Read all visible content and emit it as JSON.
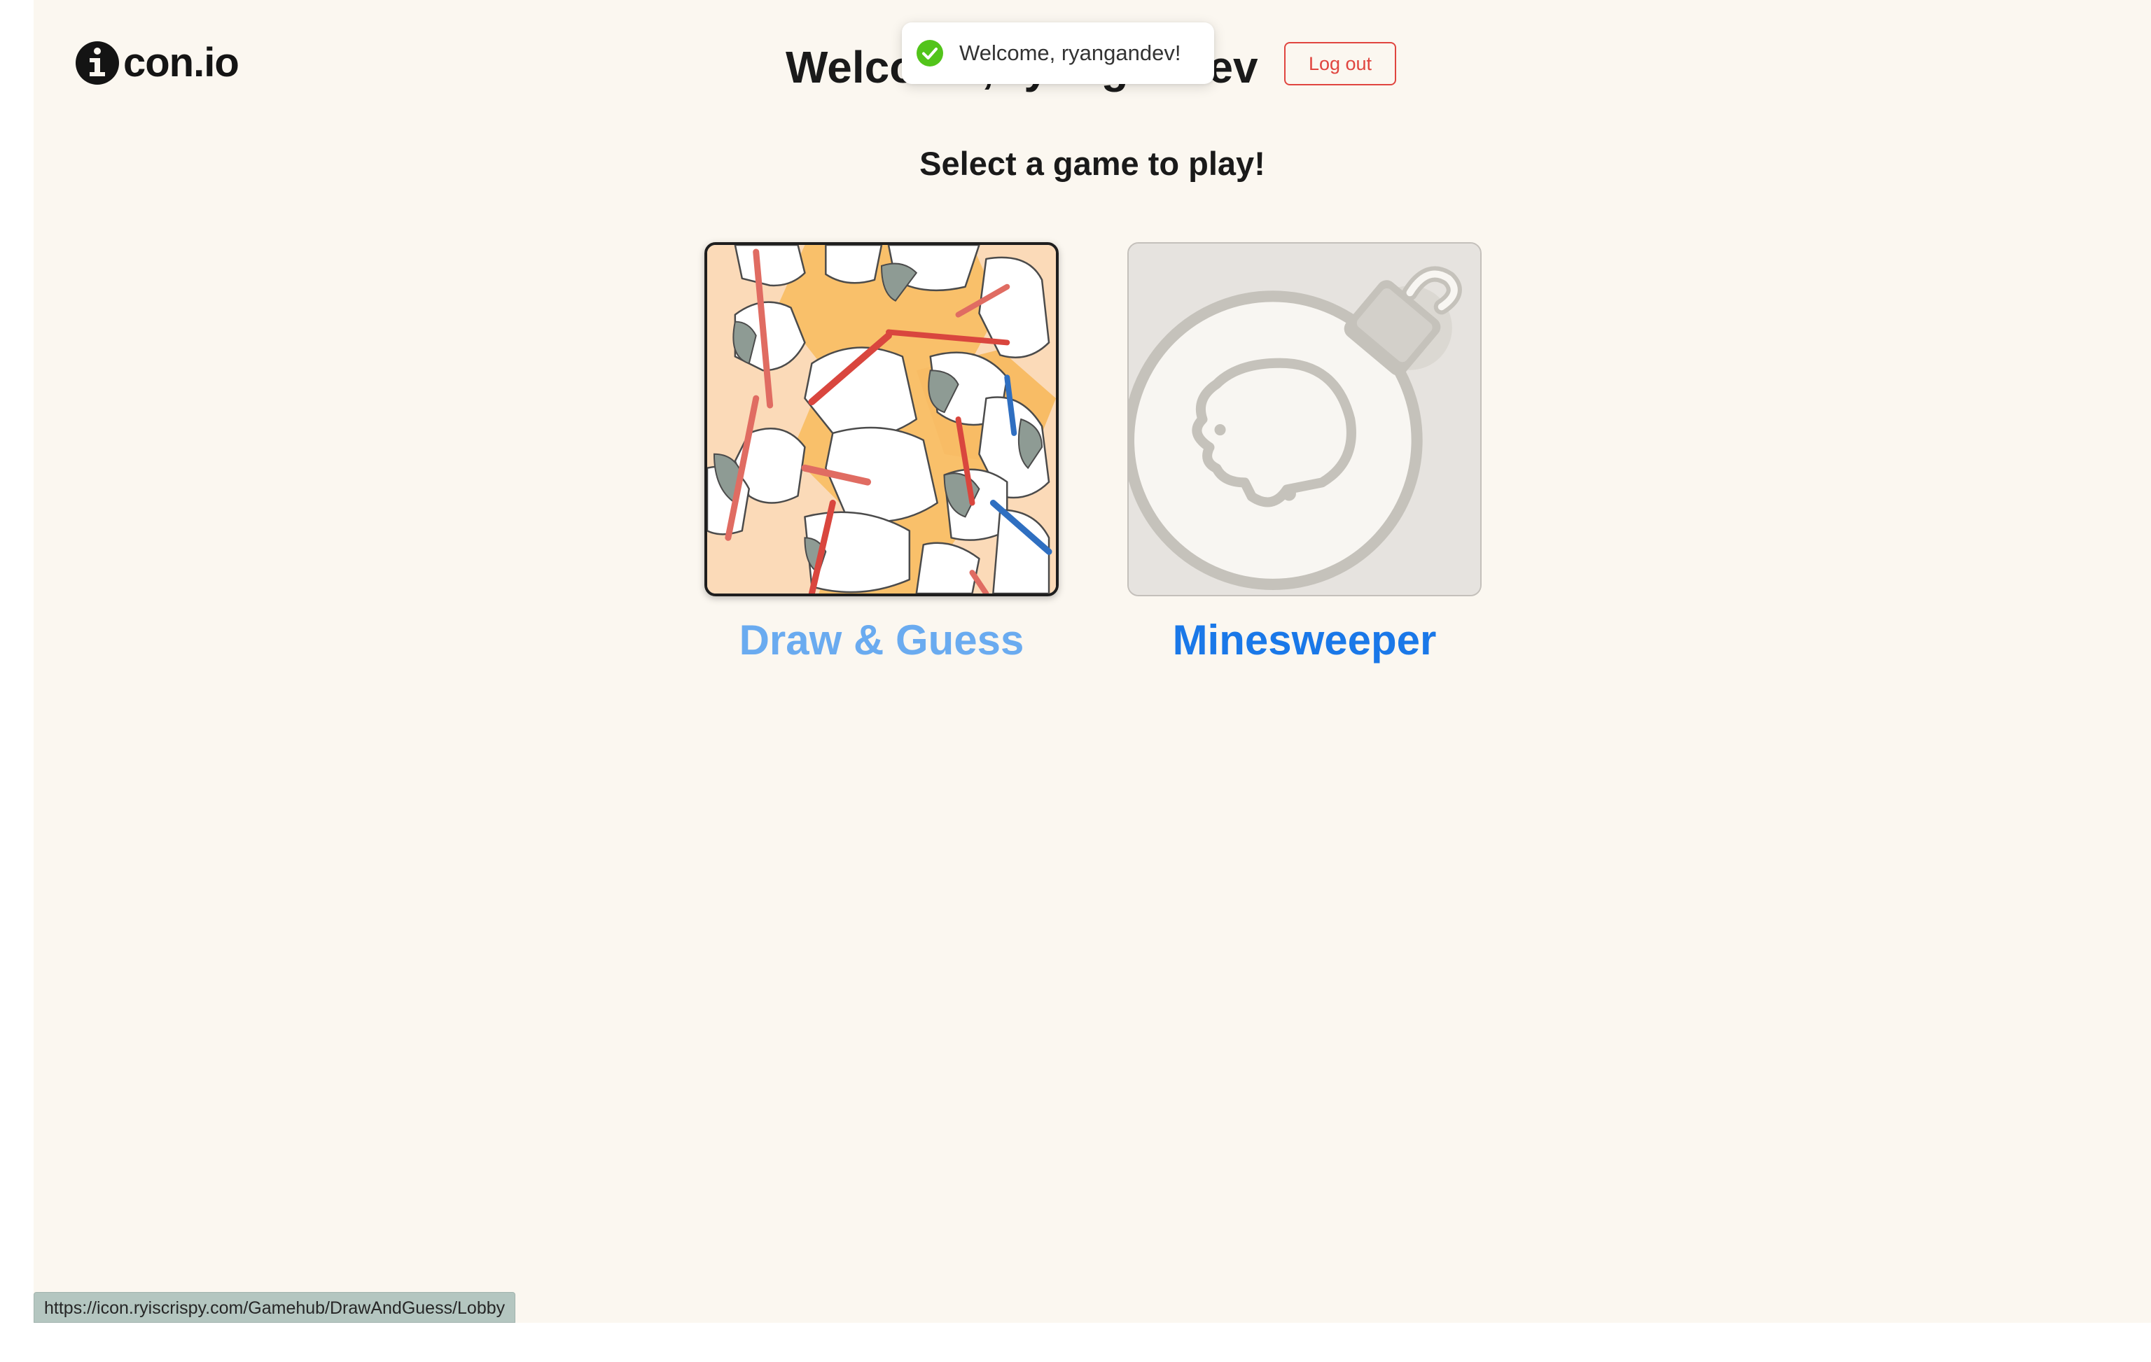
{
  "app": {
    "logo_text": "con.io",
    "logo_letter": "i"
  },
  "header": {
    "welcome_title": "Welcome, ryangandev!",
    "logout_label": "Log out"
  },
  "toast": {
    "message": "Welcome, ryangandev!",
    "status": "success",
    "color": "#52c41a"
  },
  "main": {
    "subtitle": "Select a game to play!",
    "games": [
      {
        "name": "Draw & Guess",
        "icon": "hands-drawing-illustration",
        "state": "hovered",
        "color": "#6aabf0"
      },
      {
        "name": "Minesweeper",
        "icon": "bomb-skull-icon",
        "state": "default",
        "color": "#1a78e8"
      }
    ]
  },
  "status_bar": {
    "url": "https://icon.ryiscrispy.com/Gamehub/DrawAndGuess/Lobby"
  }
}
